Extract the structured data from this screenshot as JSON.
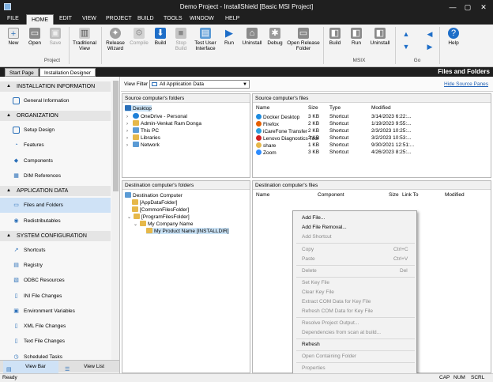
{
  "window": {
    "title": "Demo Project - InstallShield [Basic MSI Project]",
    "minimize": "—",
    "restore": "▢",
    "close": "✕"
  },
  "menu": [
    "FILE",
    "HOME",
    "EDIT",
    "VIEW",
    "PROJECT",
    "BUILD",
    "TOOLS",
    "WINDOW",
    "HELP"
  ],
  "ribbon": {
    "new": "New",
    "open": "Open",
    "save": "Save",
    "traditional_view_1": "Traditional",
    "traditional_view_2": "View",
    "release_wizard_1": "Release",
    "release_wizard_2": "Wizard",
    "compile": "Compile",
    "build": "Build",
    "stop_build_1": "Stop",
    "stop_build_2": "Build",
    "test_ui_1": "Test User",
    "test_ui_2": "Interface",
    "run": "Run",
    "uninstall": "Uninstall",
    "debug": "Debug",
    "open_release_1": "Open Release",
    "open_release_2": "Folder",
    "msix_build": "Build",
    "msix_run": "Run",
    "msix_uninstall": "Uninstall",
    "help": "Help",
    "groups": {
      "project": "Project",
      "msix": "MSIX",
      "go": "Go"
    }
  },
  "tabs": {
    "start_page": "Start Page",
    "installation_designer": "Installation Designer",
    "page_header": "Files and Folders"
  },
  "sidebar": {
    "categories": {
      "installation_information": "INSTALLATION INFORMATION",
      "organization": "ORGANIZATION",
      "application_data": "APPLICATION DATA",
      "system_configuration": "SYSTEM CONFIGURATION"
    },
    "items": {
      "general_information": "General Information",
      "setup_design": "Setup Design",
      "features": "Features",
      "components": "Components",
      "dim_references": "DIM References",
      "files_and_folders": "Files and Folders",
      "redistributables": "Redistributables",
      "shortcuts": "Shortcuts",
      "registry": "Registry",
      "odbc_resources": "ODBC Resources",
      "ini_file_changes": "INI File Changes",
      "environment_variables": "Environment Variables",
      "xml_file_changes": "XML File Changes",
      "text_file_changes": "Text File Changes",
      "scheduled_tasks": "Scheduled Tasks"
    },
    "view_bar": "View Bar",
    "view_list": "View List"
  },
  "filter": {
    "label": "View Filter",
    "value": "All Application Data",
    "hide_link": "Hide Source Panes"
  },
  "source_folders": {
    "title": "Source computer's folders",
    "desktop": "Desktop",
    "nodes": [
      "OneDrive - Personal",
      "Admin-Venkat Ram Donga",
      "This PC",
      "Libraries",
      "Network"
    ]
  },
  "source_files": {
    "title": "Source computer's files",
    "columns": {
      "name": "Name",
      "size": "Size",
      "type": "Type",
      "modified": "Modified"
    },
    "rows": [
      {
        "name": "Docker Desktop",
        "size": "3 KB",
        "type": "Shortcut",
        "modified": "3/14/2023 6:22:..."
      },
      {
        "name": "Firefox",
        "size": "2 KB",
        "type": "Shortcut",
        "modified": "1/19/2023 9:55:..."
      },
      {
        "name": "iCareFone Transfer",
        "size": "2 KB",
        "type": "Shortcut",
        "modified": "2/3/2023 10:25:..."
      },
      {
        "name": "Lenovo Diagnostics Tool",
        "size": "2 KB",
        "type": "Shortcut",
        "modified": "3/2/2023 10:53:..."
      },
      {
        "name": "share",
        "size": "1 KB",
        "type": "Shortcut",
        "modified": "9/30/2021 12:51:..."
      },
      {
        "name": "Zoom",
        "size": "3 KB",
        "type": "Shortcut",
        "modified": "4/26/2023 8:25:..."
      }
    ]
  },
  "dest_folders": {
    "title": "Destination computer's folders",
    "root": "Destination Computer",
    "app_data": "[AppDataFolder]",
    "common_files": "[CommonFilesFolder]",
    "program_files": "[ProgramFilesFolder]",
    "company": "My Company Name",
    "product": "My Product Name [INSTALLDIR]"
  },
  "dest_files": {
    "title": "Destination computer's files",
    "columns": {
      "name": "Name",
      "component": "Component",
      "size": "Size",
      "link_to": "Link To",
      "modified": "Modified"
    }
  },
  "context_menu": {
    "add_file": "Add File...",
    "add_file_removal": "Add File Removal...",
    "add_shortcut": "Add Shortcut",
    "copy": "Copy",
    "copy_sc": "Ctrl+C",
    "paste": "Paste",
    "paste_sc": "Ctrl+V",
    "delete": "Delete",
    "delete_sc": "Del",
    "set_key_file": "Set Key File",
    "clear_key_file": "Clear Key File",
    "extract_com": "Extract COM Data for Key File",
    "refresh_com": "Refresh COM Data for Key File",
    "resolve_output": "Resolve Project Output...",
    "dependencies": "Dependencies from scan at build...",
    "refresh": "Refresh",
    "open_containing": "Open Containing Folder",
    "properties": "Properties"
  },
  "status": {
    "ready": "Ready",
    "cap": "CAP",
    "num": "NUM",
    "scrl": "SCRL"
  }
}
